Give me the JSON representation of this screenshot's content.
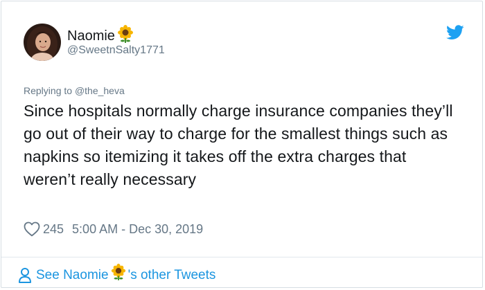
{
  "tweet": {
    "author": {
      "name": "Naomie",
      "name_emoji": "sunflower-emoji",
      "handle": "@SweetnSalty1771",
      "avatar": "profile-photo-avatar"
    },
    "replying_prefix": "Replying to",
    "replying_to": "@the_heva",
    "text": "Since hospitals normally charge insurance companies they’ll go out of their way to charge for the smallest things such as napkins so itemizing it takes off the extra charges that weren’t really necessary",
    "likes": "245",
    "timestamp": "5:00 AM - Dec 30, 2019",
    "footer": {
      "prefix": "See Naomie",
      "suffix": "'s other Tweets"
    }
  },
  "colors": {
    "text": "#14171a",
    "secondary": "#657786",
    "accent": "#1b95e0",
    "twitter_blue": "#1da1f2",
    "border": "#d6dde3"
  },
  "icons": [
    "twitter-bird-icon",
    "heart-icon",
    "person-icon",
    "sunflower-emoji"
  ]
}
